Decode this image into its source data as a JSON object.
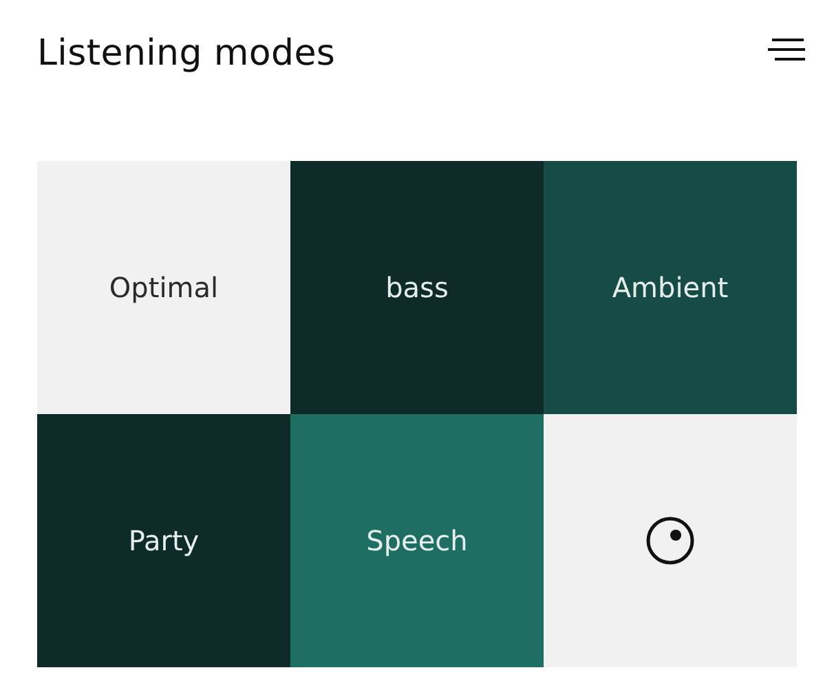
{
  "header": {
    "title": "Listening modes"
  },
  "modes": [
    {
      "kind": "label",
      "label": "Optimal",
      "color": "#f1f1f1"
    },
    {
      "kind": "label",
      "label": "bass",
      "color": "#0e2a29"
    },
    {
      "kind": "label",
      "label": "Ambient",
      "color": "#174b46"
    },
    {
      "kind": "label",
      "label": "Party",
      "color": "#0e2a29"
    },
    {
      "kind": "label",
      "label": "Speech",
      "color": "#1f6e64"
    },
    {
      "kind": "icon",
      "color": "#f1f1f1"
    }
  ]
}
